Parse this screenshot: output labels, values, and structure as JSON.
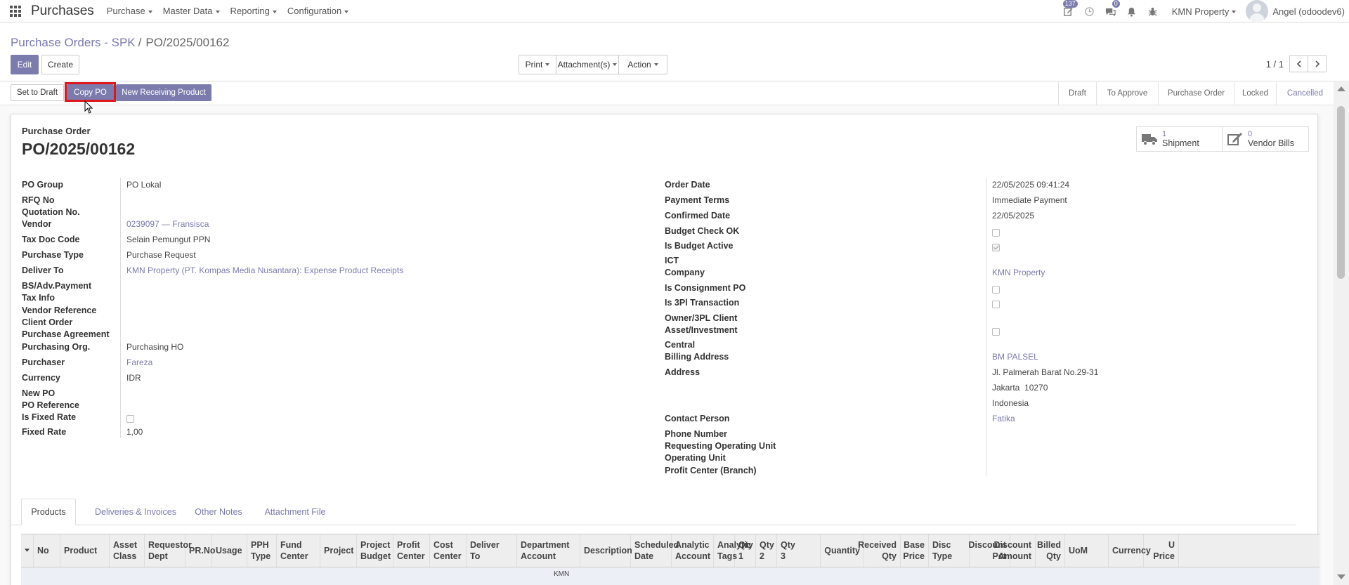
{
  "navbar": {
    "app_title": "Purchases",
    "menus": [
      "Purchase",
      "Master Data",
      "Reporting",
      "Configuration"
    ],
    "activity_badge": "137",
    "messages_badge": "0",
    "company": "KMN Property",
    "user": "Angel (odoodev6)"
  },
  "breadcrumb": {
    "parent": "Purchase Orders - SPK",
    "separator": "/",
    "current": "PO/2025/00162"
  },
  "buttons": {
    "edit": "Edit",
    "create": "Create",
    "print": "Print",
    "attachments": "Attachment(s)",
    "action": "Action"
  },
  "pager": {
    "value": "1 / 1"
  },
  "statusbar": {
    "set_to_draft": "Set to Draft",
    "copy_po": "Copy PO",
    "new_receiving": "New Receiving Product",
    "stages": [
      "Draft",
      "To Approve",
      "Purchase Order",
      "Locked",
      "Cancelled"
    ],
    "active_stage": "Cancelled"
  },
  "form": {
    "doc_type": "Purchase Order",
    "name": "PO/2025/00162",
    "smart_buttons": [
      {
        "count": "1",
        "label": "Shipment",
        "icon": "truck-icon"
      },
      {
        "count": "0",
        "label": "Vendor Bills",
        "icon": "edit-icon"
      }
    ],
    "left": {
      "po_group_label": "PO Group",
      "po_group": "PO Lokal",
      "rfq_label": "RFQ No",
      "quotation_label": "Quotation No.",
      "vendor_label": "Vendor",
      "vendor": "0239097 — Fransisca",
      "tax_doc_label": "Tax Doc Code",
      "tax_doc": "Selain Pemungut PPN",
      "purchase_type_label": "Purchase Type",
      "purchase_type": "Purchase Request",
      "deliver_to_label": "Deliver To",
      "deliver_to": "KMN Property (PT. Kompas Media Nusantara): Expense Product Receipts",
      "bs_label": "BS/Adv.Payment",
      "tax_info_label": "Tax Info",
      "vendor_ref_label": "Vendor Reference",
      "client_order_label": "Client Order",
      "agreement_label": "Purchase Agreement",
      "purch_org_label": "Purchasing Org.",
      "purch_org": "Purchasing HO",
      "purchaser_label": "Purchaser",
      "purchaser": "Fareza",
      "currency_label": "Currency",
      "currency": "IDR",
      "new_po_label": "New PO",
      "po_ref_label": "PO Reference",
      "fixed_rate_flag_label": "Is Fixed Rate",
      "fixed_rate_label": "Fixed Rate",
      "fixed_rate": "1,00"
    },
    "right": {
      "order_date_label": "Order Date",
      "order_date": "22/05/2025 09:41:24",
      "payment_terms_label": "Payment Terms",
      "payment_terms": "Immediate Payment",
      "confirmed_label": "Confirmed Date",
      "confirmed": "22/05/2025",
      "budget_ok_label": "Budget Check OK",
      "budget_active_label": "Is Budget Active",
      "ict_label": "ICT",
      "company_label": "Company",
      "company": "KMN Property",
      "consignment_label": "Is Consignment PO",
      "tpl_label": "Is 3Pl Transaction",
      "owner_label": "Owner/3PL Client",
      "asset_label": "Asset/Investment",
      "central_label": "Central",
      "billing_label": "Billing Address",
      "billing": "BM PALSEL",
      "address_label": "Address",
      "address_line1": "Jl. Palmerah Barat No.29-31",
      "address_line2": "Jakarta  10270",
      "address_line3": "Indonesia",
      "contact_label": "Contact Person",
      "contact": "Fatika",
      "phone_label": "Phone Number",
      "req_unit_label": "Requesting Operating Unit",
      "op_unit_label": "Operating Unit",
      "profit_center_label": "Profit Center (Branch)"
    }
  },
  "tabs": [
    "Products",
    "Deliveries & Invoices",
    "Other Notes",
    "Attachment File"
  ],
  "table": {
    "columns": [
      [
        "No"
      ],
      [
        "Product"
      ],
      [
        "Asset",
        "Class"
      ],
      [
        "Requestor",
        "Dept"
      ],
      [
        "PR.No"
      ],
      [
        "Usage"
      ],
      [
        "PPH",
        "Type"
      ],
      [
        "Fund",
        "Center"
      ],
      [
        "Project"
      ],
      [
        "Project",
        "Budget"
      ],
      [
        "Profit",
        "Center"
      ],
      [
        "Cost",
        "Center"
      ],
      [
        "Deliver",
        "To"
      ],
      [
        "Department",
        "Account"
      ],
      [
        "Description"
      ],
      [
        "Scheduled",
        "Date"
      ],
      [
        "Analytic",
        "Account"
      ],
      [
        "Analytic",
        "Tags"
      ],
      [
        "Qty",
        "1"
      ],
      [
        "Qty",
        "2"
      ],
      [
        "Qty",
        "3"
      ],
      [
        "Quantity"
      ],
      [
        "Received",
        "Qty"
      ],
      [
        "Base",
        "Price"
      ],
      [
        "Disc",
        "Type"
      ],
      [
        "Discount",
        "Pct"
      ],
      [
        "Discount",
        "Amount"
      ],
      [
        "Billed",
        "Qty"
      ],
      [
        "UoM"
      ],
      [
        "Currency"
      ],
      [
        "U",
        "Price"
      ]
    ],
    "peek_text": "KMN"
  }
}
